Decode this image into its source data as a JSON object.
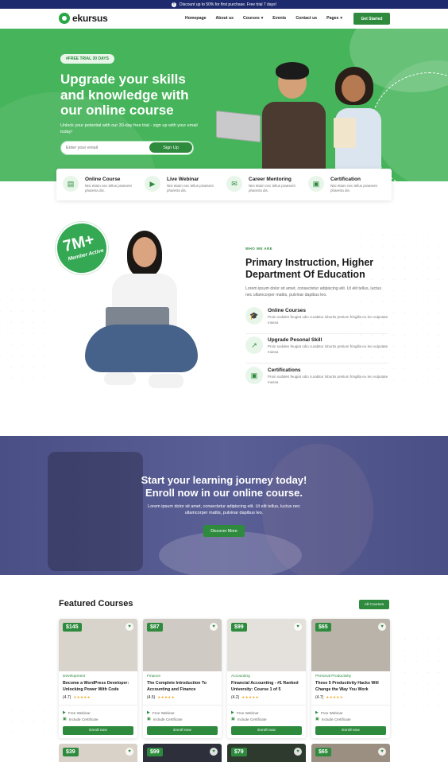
{
  "announcement": {
    "text": "Discount up to 50% for first purchase. Free trial 7 days!"
  },
  "brand": {
    "name": "ekursus",
    "accent": "#2e8b3e",
    "hero_bg": "#46b45a",
    "banner_bg": "#1e2a6e"
  },
  "nav": {
    "items": [
      {
        "label": "Homepage"
      },
      {
        "label": "About us"
      },
      {
        "label": "Courses",
        "caret": "▾"
      },
      {
        "label": "Events"
      },
      {
        "label": "Contact us"
      },
      {
        "label": "Pages",
        "caret": "▾"
      }
    ],
    "cta_label": "Get Started"
  },
  "hero": {
    "badge": "#FREE TRIAL 30 DAYS",
    "title": "Upgrade your skills and knowledge with our online course",
    "subtitle": "Unlock your potential with our 30-day free trial - sign up with your email today!",
    "email_placeholder": "Enter your email",
    "signup_label": "Sign Up"
  },
  "features": [
    {
      "title": "Online Course",
      "desc": "Nisi etiam nec tellus praesent pharetra dis.",
      "icon": "book-icon",
      "glyph": "▤"
    },
    {
      "title": "Live Webinar",
      "desc": "Nisi etiam nec tellus praesent pharetra dis.",
      "icon": "video-icon",
      "glyph": "▶"
    },
    {
      "title": "Career Mentoring",
      "desc": "Nisi etiam nec tellus praesent pharetra dis.",
      "icon": "chat-icon",
      "glyph": "✉"
    },
    {
      "title": "Certification",
      "desc": "Nisi etiam nec tellus praesent pharetra dis.",
      "icon": "certificate-icon",
      "glyph": "▣"
    }
  ],
  "about": {
    "stat_number": "7M+",
    "stat_label": "Member Active",
    "eyebrow": "WHO WE ARE",
    "title": "Primary Instruction, Higher Department Of Education",
    "desc": "Lorem ipsum dolor sit amet, consectetur adipiscing elit. Ut elit tellus, luctus nec ullamcorper mattis, pulvinar dapibus leo.",
    "items": [
      {
        "title": "Online Courses",
        "desc": "Proin sodales feugiat odio curabitur lobortis pretium fringilla eu leo vulputate massa",
        "icon": "graduation-cap-icon",
        "glyph": "🎓"
      },
      {
        "title": "Upgrade Pesonal Skill",
        "desc": "Proin sodales feugiat odio curabitur lobortis pretium fringilla eu leo vulputate massa",
        "icon": "chart-line-icon",
        "glyph": "↗"
      },
      {
        "title": "Certifications",
        "desc": "Proin sodales feugiat odio curabitur lobortis pretium fringilla eu leo vulputate massa",
        "icon": "certificate-icon",
        "glyph": "▣"
      }
    ]
  },
  "cta": {
    "title": "Start your learning journey today! Enroll now in our online course.",
    "desc": "Lorem ipsum dolor sit amet, consectetur adipiscing elit. Ut elit tellus, luctus nec ullamcorper mattis, pulvinar dapibus leo.",
    "button": "Discover More"
  },
  "featured": {
    "title": "Featured Courses",
    "all_label": "All Courses",
    "courses": [
      {
        "price": "$145",
        "category": "Development",
        "name": "Become a WordPress Developer: Unlocking Power With Code",
        "rating": "(4.7)",
        "stars": "★★★★★",
        "feature1": "Free Webinar",
        "feature2": "Include Certificate",
        "enroll": "Enroll now",
        "bg": "#d8d4cc"
      },
      {
        "price": "$87",
        "category": "Finance",
        "name": "The Complete Introduction To Accounting and Finance",
        "rating": "(4.5)",
        "stars": "★★★★★",
        "feature1": "Free Webinar",
        "feature2": "Include Certificate",
        "enroll": "Enroll now",
        "bg": "#cfcac4"
      },
      {
        "price": "$99",
        "category": "Accounting",
        "name": "Financial Accounting - #1 Ranked University: Course 1 of 5",
        "rating": "(4.2)",
        "stars": "★★★★★",
        "feature1": "Free Webinar",
        "feature2": "Include Certificate",
        "enroll": "Enroll now",
        "bg": "#e4e1dc"
      },
      {
        "price": "$65",
        "category": "Personal Productivity",
        "name": "These 5 Productivity Hacks Will Change the Way You Work",
        "rating": "(4.7)",
        "stars": "★★★★★",
        "feature1": "Free Webinar",
        "feature2": "Include Certificate",
        "enroll": "Enroll now",
        "bg": "#b9b3aa"
      }
    ],
    "next_row": [
      {
        "price": "$39",
        "bg": "#d9d2c8"
      },
      {
        "price": "$99",
        "bg": "#2d2f3a"
      },
      {
        "price": "$79",
        "bg": "#2e3a2e"
      },
      {
        "price": "$65",
        "bg": "#9a8f80"
      }
    ]
  }
}
